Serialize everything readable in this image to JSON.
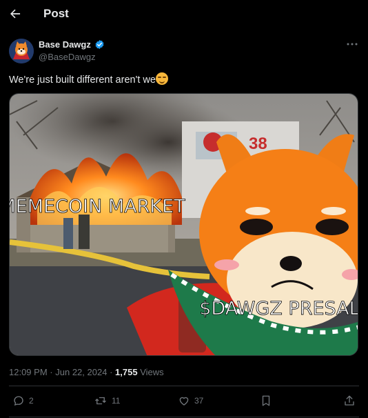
{
  "header": {
    "title": "Post",
    "back_icon": "arrow-left-icon"
  },
  "author": {
    "name": "Base Dawgz",
    "handle": "@BaseDawgz",
    "verified": true
  },
  "tweet": {
    "text": "We're just built different aren't we",
    "emoji": "smirking-face",
    "image_text_left": "MEMECOIN MARKET",
    "image_text_right": "$DAWGZ PRESALE",
    "image_number": "38"
  },
  "meta": {
    "time": "12:09 PM",
    "sep": "·",
    "date": "Jun 22, 2024",
    "sep2": "·",
    "views_count": "1,755",
    "views_label": "Views"
  },
  "actions": {
    "replies": "2",
    "reposts": "11",
    "likes": "37"
  },
  "colors": {
    "background": "#000000",
    "text": "#e7e9ea",
    "muted": "#71767b",
    "verified": "#1d9bf0"
  }
}
